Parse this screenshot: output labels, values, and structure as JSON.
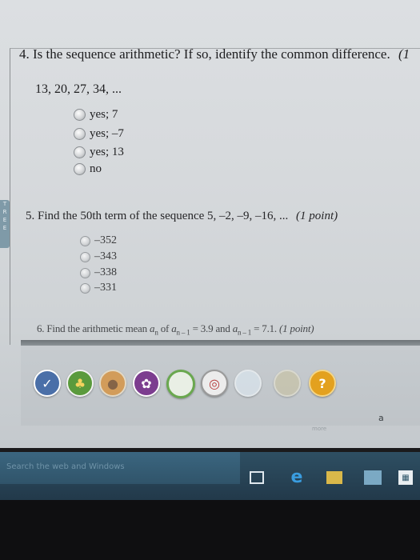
{
  "q4": {
    "title": "4. Is the sequence arithmetic? If so, identify the common difference.",
    "points_fragment": "(1",
    "sequence": "13, 20, 27, 34, ...",
    "options": [
      "yes; 7",
      "yes; –7",
      "yes; 13",
      "no"
    ]
  },
  "q5": {
    "prompt": "5. Find the 50th term of the sequence 5, –2, –9, –16, ...",
    "points": "(1 point)",
    "options": [
      "–352",
      "–343",
      "–338",
      "–331"
    ]
  },
  "q6": {
    "lead": "6. Find the arithmetic mean",
    "a": "a",
    "sub_n": "n",
    "of": "of",
    "sub_n1": "n – 1",
    "eq1": "= 3.9 and",
    "eq2": "= 7.1.",
    "points": "(1 point)"
  },
  "gutter_letters": [
    "T",
    "R",
    "E",
    "E"
  ],
  "toolbar": {
    "icons": [
      "check-icon",
      "leaf-icon",
      "palette-icon",
      "star-badge-icon",
      "ring-icon",
      "target-icon",
      "cloud-icon",
      "folder-icon",
      "help-icon"
    ],
    "colors": [
      "#4a6fa8",
      "#5a9a3c",
      "#d98a2b",
      "#7c3d8f",
      "#6aa84f",
      "#e4e4e4",
      "#d9e4ec",
      "#c8c2a0",
      "#e3a11f"
    ],
    "help_glyph": "?",
    "label": "more",
    "corner": "a"
  },
  "taskbar": {
    "search_placeholder": "Search the web and Windows",
    "icons": [
      "task-view-icon",
      "edge-icon",
      "explorer-icon",
      "photos-icon",
      "store-icon"
    ]
  }
}
